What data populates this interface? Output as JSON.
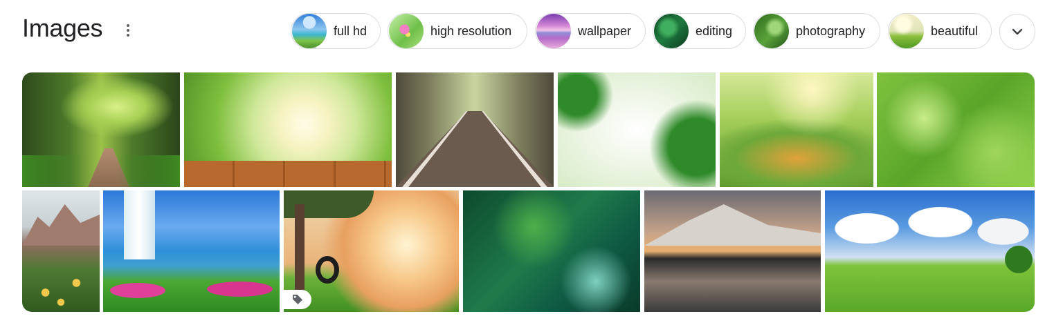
{
  "header": {
    "title": "Images"
  },
  "chips": [
    {
      "label": "full hd",
      "icon": "chip-thumb-lake"
    },
    {
      "label": "high resolution",
      "icon": "chip-thumb-flower"
    },
    {
      "label": "wallpaper",
      "icon": "chip-thumb-sunset-lake"
    },
    {
      "label": "editing",
      "icon": "chip-thumb-forest"
    },
    {
      "label": "photography",
      "icon": "chip-thumb-bokeh"
    },
    {
      "label": "beautiful",
      "icon": "chip-thumb-meadow"
    }
  ],
  "expand_icon": "chevron-down-icon",
  "images": {
    "row1": [
      "park path with bench",
      "sunlit wooden table",
      "tree-lined road",
      "green leaves frame",
      "bokeh garden",
      "green bokeh"
    ],
    "row2": [
      "mountain flowers",
      "waterfall lake garden",
      "tree with tire swing",
      "green leaves bokeh",
      "mountain lake reflection",
      "green hill and clouds"
    ]
  },
  "colors": {
    "text": "#202124",
    "border": "#dadce0",
    "icon": "#5f6368"
  }
}
